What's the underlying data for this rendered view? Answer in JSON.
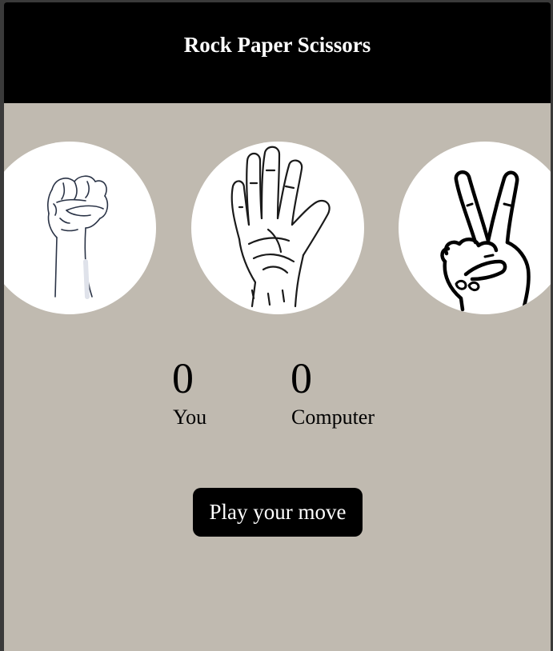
{
  "header": {
    "title": "Rock Paper Scissors"
  },
  "choices": [
    {
      "name": "rock",
      "icon": "rock-fist-icon"
    },
    {
      "name": "paper",
      "icon": "paper-hand-icon"
    },
    {
      "name": "scissors",
      "icon": "scissors-hand-icon"
    }
  ],
  "scoreboard": {
    "you": {
      "value": "0",
      "label": "You"
    },
    "computer": {
      "value": "0",
      "label": "Computer"
    }
  },
  "play_button": {
    "label": "Play your move"
  },
  "colors": {
    "header_bg": "#000000",
    "page_bg": "#c0bab0",
    "button_bg": "#000000",
    "button_text": "#ffffff"
  }
}
